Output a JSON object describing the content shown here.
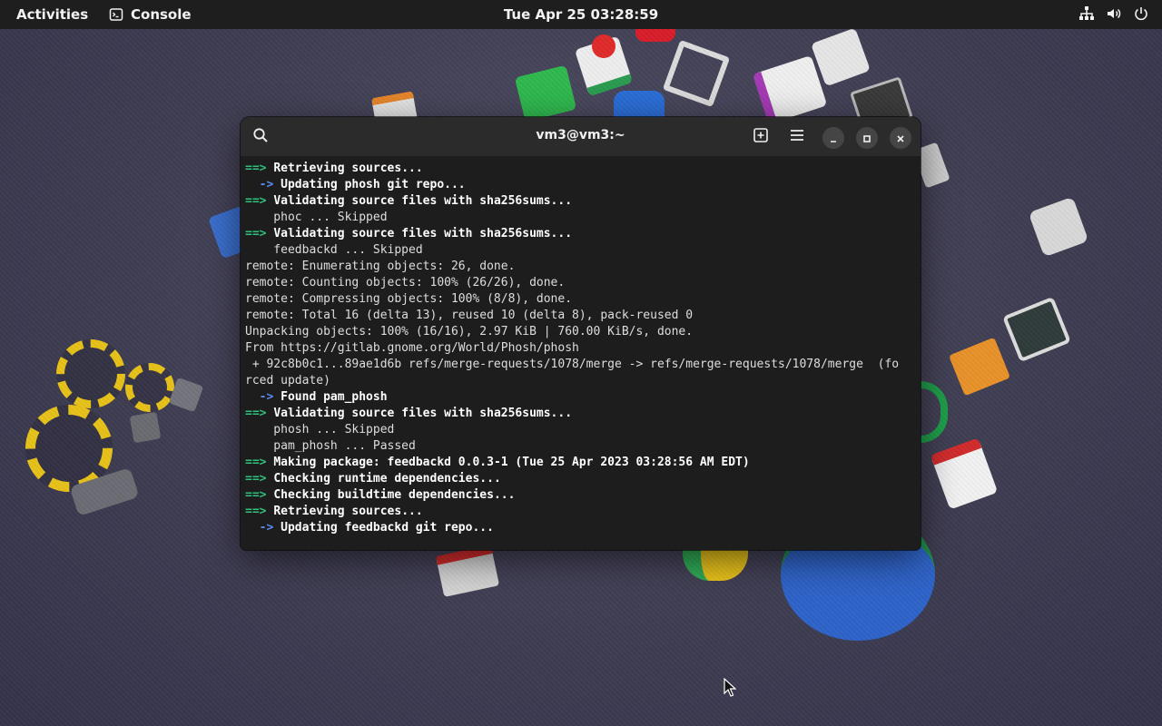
{
  "topbar": {
    "activities": "Activities",
    "app_name": "Console",
    "clock": "Tue Apr 25  03:28:59"
  },
  "window": {
    "title": "vm3@vm3:~"
  },
  "terminal": {
    "lines": [
      {
        "prefix": "==>",
        "prefix_color": "green",
        "text": "Retrieving sources...",
        "bold": true
      },
      {
        "prefix": "  ->",
        "prefix_color": "blue",
        "text": "Updating phosh git repo...",
        "bold": true
      },
      {
        "prefix": "==>",
        "prefix_color": "green",
        "text": "Validating source files with sha256sums...",
        "bold": true
      },
      {
        "prefix": "",
        "prefix_color": "",
        "text": "    phoc ... Skipped",
        "bold": false
      },
      {
        "prefix": "==>",
        "prefix_color": "green",
        "text": "Validating source files with sha256sums...",
        "bold": true
      },
      {
        "prefix": "",
        "prefix_color": "",
        "text": "    feedbackd ... Skipped",
        "bold": false
      },
      {
        "prefix": "",
        "prefix_color": "",
        "text": "remote: Enumerating objects: 26, done.",
        "bold": false
      },
      {
        "prefix": "",
        "prefix_color": "",
        "text": "remote: Counting objects: 100% (26/26), done.",
        "bold": false
      },
      {
        "prefix": "",
        "prefix_color": "",
        "text": "remote: Compressing objects: 100% (8/8), done.",
        "bold": false
      },
      {
        "prefix": "",
        "prefix_color": "",
        "text": "remote: Total 16 (delta 13), reused 10 (delta 8), pack-reused 0",
        "bold": false
      },
      {
        "prefix": "",
        "prefix_color": "",
        "text": "Unpacking objects: 100% (16/16), 2.97 KiB | 760.00 KiB/s, done.",
        "bold": false
      },
      {
        "prefix": "",
        "prefix_color": "",
        "text": "From https://gitlab.gnome.org/World/Phosh/phosh",
        "bold": false
      },
      {
        "prefix": "",
        "prefix_color": "",
        "text": " + 92c8b0c1...89ae1d6b refs/merge-requests/1078/merge -> refs/merge-requests/1078/merge  (fo",
        "bold": false
      },
      {
        "prefix": "",
        "prefix_color": "",
        "text": "rced update)",
        "bold": false
      },
      {
        "prefix": "  ->",
        "prefix_color": "blue",
        "text": "Found pam_phosh",
        "bold": true
      },
      {
        "prefix": "==>",
        "prefix_color": "green",
        "text": "Validating source files with sha256sums...",
        "bold": true
      },
      {
        "prefix": "",
        "prefix_color": "",
        "text": "    phosh ... Skipped",
        "bold": false
      },
      {
        "prefix": "",
        "prefix_color": "",
        "text": "    pam_phosh ... Passed",
        "bold": false
      },
      {
        "prefix": "==>",
        "prefix_color": "green",
        "text": "Making package: feedbackd 0.0.3-1 (Tue 25 Apr 2023 03:28:56 AM EDT)",
        "bold": true
      },
      {
        "prefix": "==>",
        "prefix_color": "green",
        "text": "Checking runtime dependencies...",
        "bold": true
      },
      {
        "prefix": "==>",
        "prefix_color": "green",
        "text": "Checking buildtime dependencies...",
        "bold": true
      },
      {
        "prefix": "==>",
        "prefix_color": "green",
        "text": "Retrieving sources...",
        "bold": true
      },
      {
        "prefix": "  ->",
        "prefix_color": "blue",
        "text": "Updating feedbackd git repo...",
        "bold": true
      }
    ]
  },
  "colors": {
    "prefix_green": "#2ec27e",
    "prefix_blue": "#5b8bf0",
    "topbar_bg": "#1e1e1e",
    "terminal_bg": "#1d1d1d"
  },
  "icons": [
    "console-icon",
    "network-icon",
    "volume-icon",
    "power-icon",
    "search-icon",
    "new-tab-icon",
    "menu-icon",
    "minimize-icon",
    "maximize-icon",
    "close-icon",
    "mouse-pointer-icon"
  ]
}
